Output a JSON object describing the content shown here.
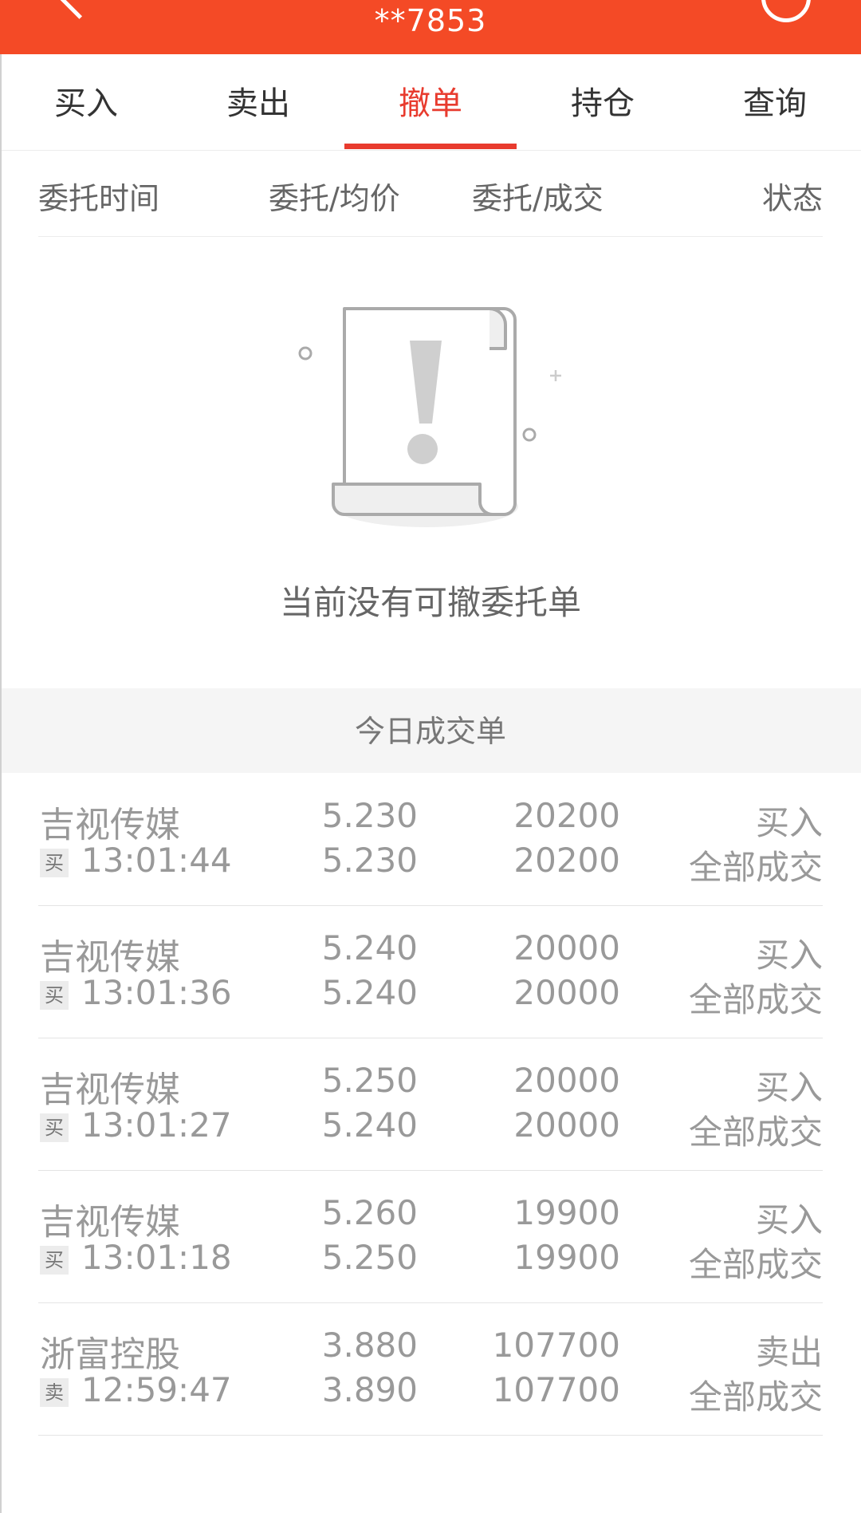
{
  "header": {
    "title": "**7853"
  },
  "tabs": [
    {
      "label": "买入",
      "active": false
    },
    {
      "label": "卖出",
      "active": false
    },
    {
      "label": "撤单",
      "active": true
    },
    {
      "label": "持仓",
      "active": false
    },
    {
      "label": "查询",
      "active": false
    }
  ],
  "columns": [
    "委托时间",
    "委托/均价",
    "委托/成交",
    "状态"
  ],
  "empty_message": "当前没有可撤委托单",
  "section_title": "今日成交单",
  "trades": [
    {
      "name": "吉视传媒",
      "badge": "买",
      "time": "13:01:44",
      "price": "5.230",
      "avg_price": "5.230",
      "qty": "20200",
      "filled": "20200",
      "direction": "买入",
      "status": "全部成交"
    },
    {
      "name": "吉视传媒",
      "badge": "买",
      "time": "13:01:36",
      "price": "5.240",
      "avg_price": "5.240",
      "qty": "20000",
      "filled": "20000",
      "direction": "买入",
      "status": "全部成交"
    },
    {
      "name": "吉视传媒",
      "badge": "买",
      "time": "13:01:27",
      "price": "5.250",
      "avg_price": "5.240",
      "qty": "20000",
      "filled": "20000",
      "direction": "买入",
      "status": "全部成交"
    },
    {
      "name": "吉视传媒",
      "badge": "买",
      "time": "13:01:18",
      "price": "5.260",
      "avg_price": "5.250",
      "qty": "19900",
      "filled": "19900",
      "direction": "买入",
      "status": "全部成交"
    },
    {
      "name": "浙富控股",
      "badge": "卖",
      "time": "12:59:47",
      "price": "3.880",
      "avg_price": "3.890",
      "qty": "107700",
      "filled": "107700",
      "direction": "卖出",
      "status": "全部成交"
    }
  ],
  "colors": {
    "header": "#f44a26",
    "accent": "#e83b2e",
    "muted": "#999999"
  },
  "icons": [
    "back-arrow-icon",
    "refresh-icon",
    "empty-document-icon"
  ]
}
